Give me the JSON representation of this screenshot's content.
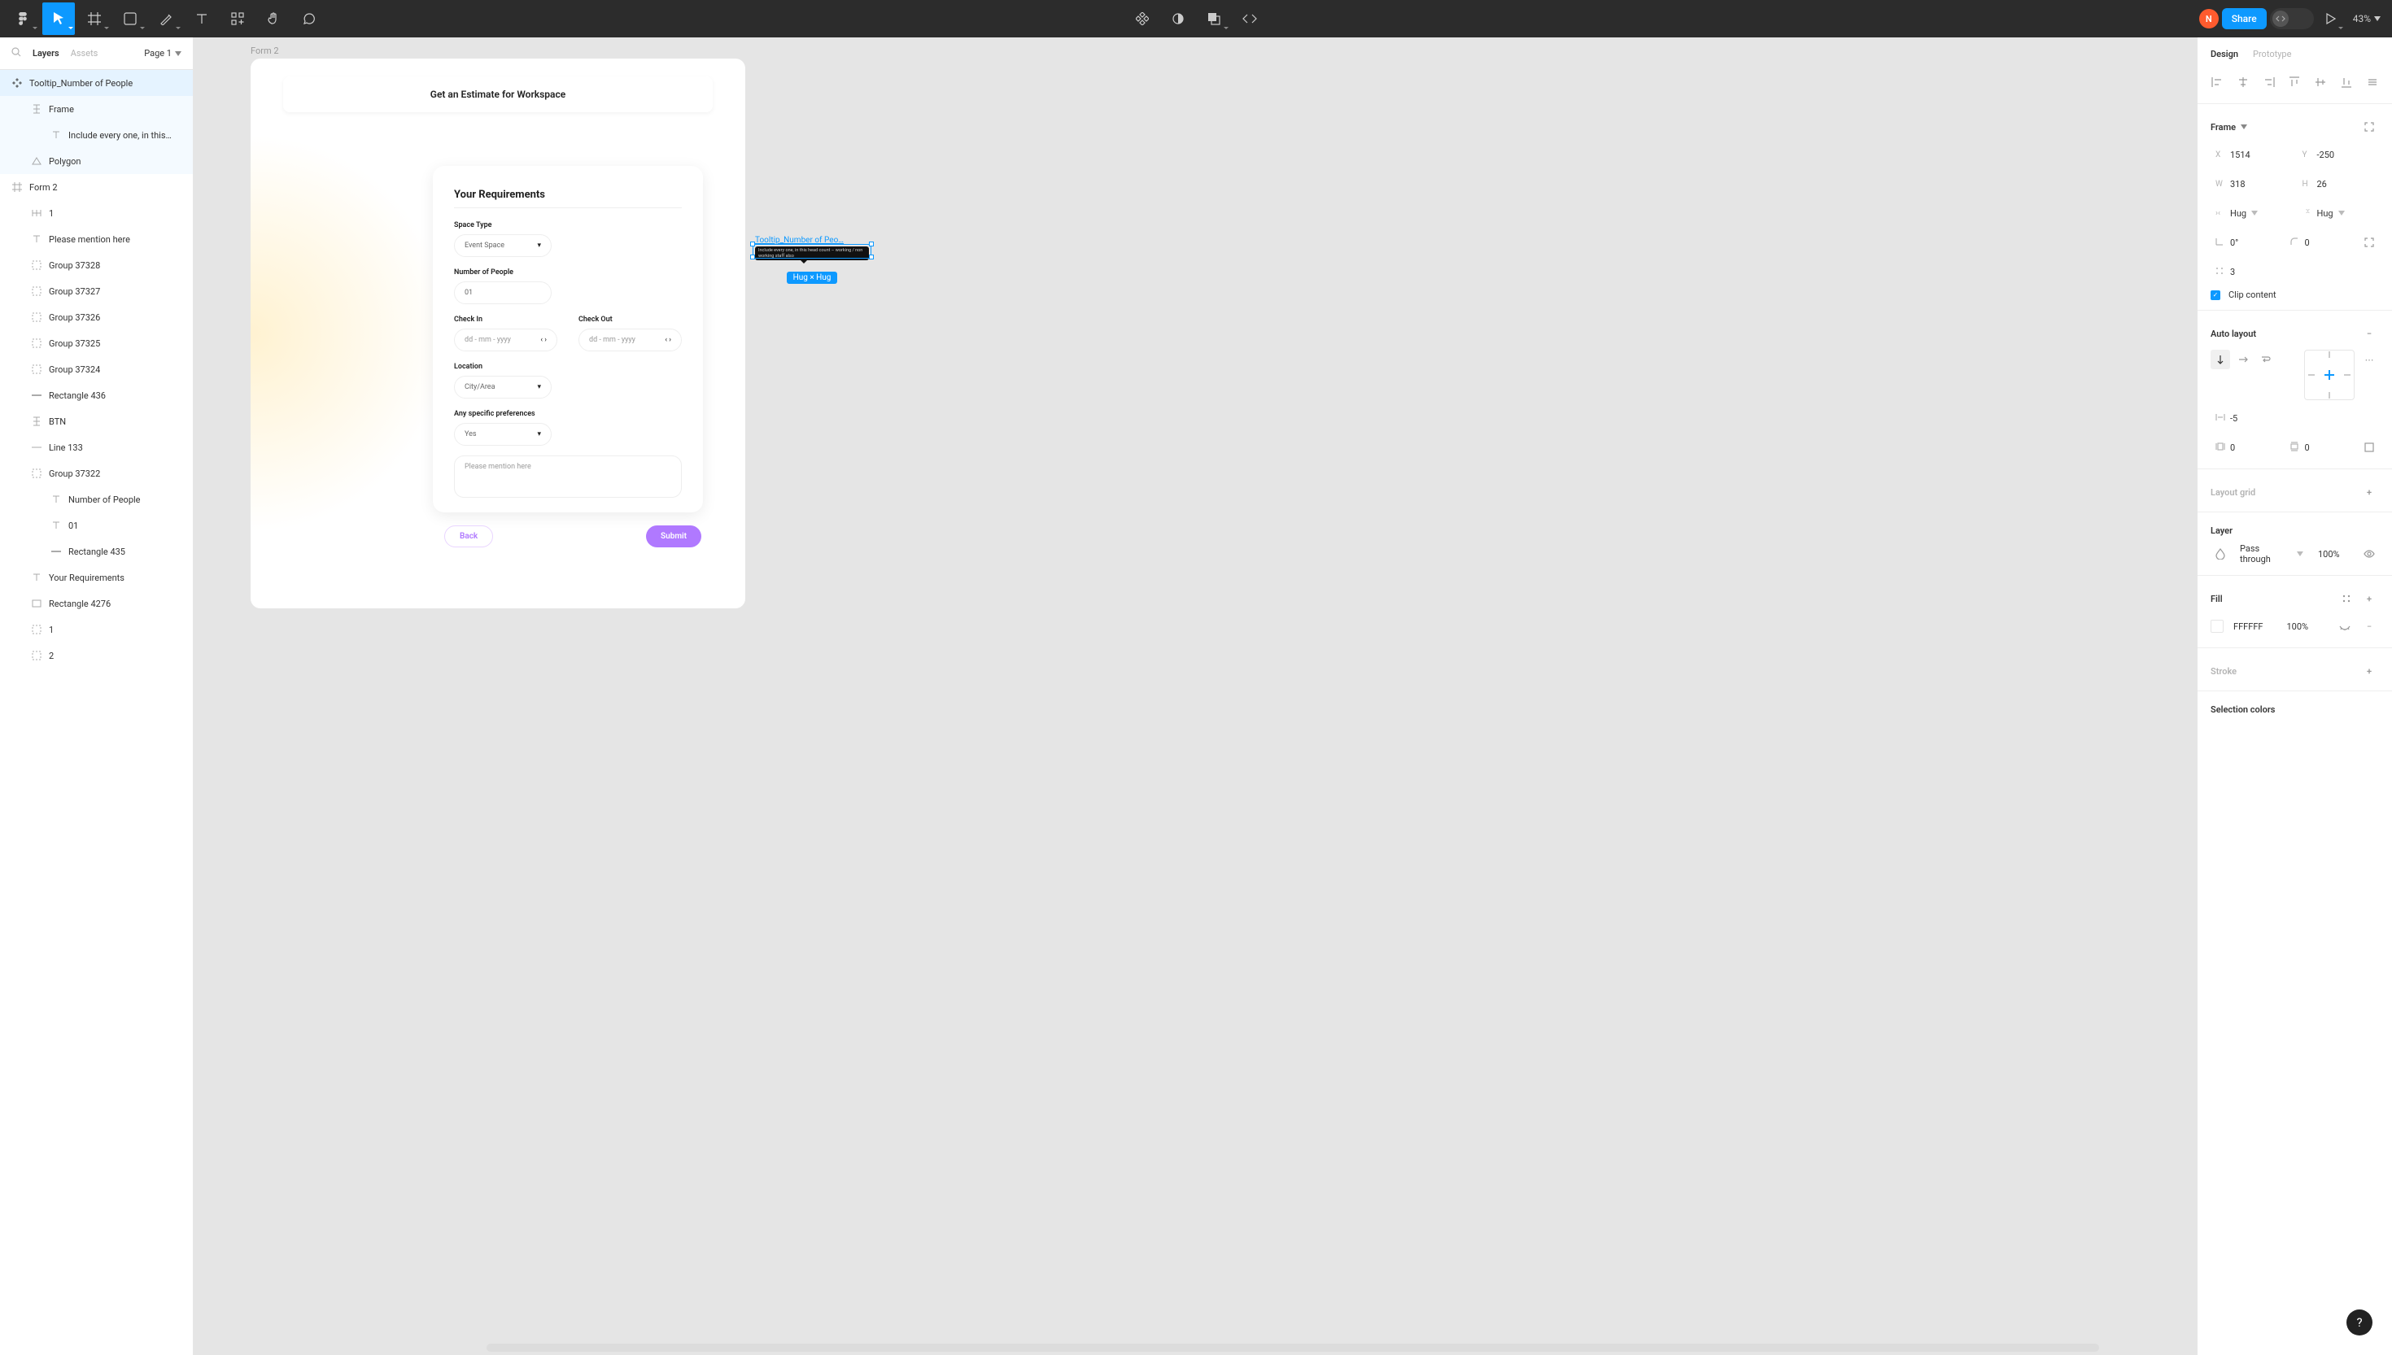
{
  "toolbar": {
    "zoom": "43%",
    "share": "Share",
    "avatar_initial": "N"
  },
  "left_panel": {
    "search_icon": "search",
    "tabs": {
      "layers": "Layers",
      "assets": "Assets"
    },
    "page_label": "Page 1",
    "layers": [
      {
        "name": "Tooltip_Number of People",
        "indent": 0,
        "icon": "component",
        "selected": true
      },
      {
        "name": "Frame",
        "indent": 1,
        "icon": "frame-v",
        "selected_inner": true
      },
      {
        "name": "Include every one, in this…",
        "indent": 2,
        "icon": "text",
        "selected_inner": true
      },
      {
        "name": "Polygon",
        "indent": 1,
        "icon": "polygon",
        "selected_inner": true
      },
      {
        "name": "Form 2",
        "indent": 0,
        "icon": "frame"
      },
      {
        "name": "1",
        "indent": 1,
        "icon": "frame-h"
      },
      {
        "name": "Please mention here",
        "indent": 1,
        "icon": "text"
      },
      {
        "name": "Group 37328",
        "indent": 1,
        "icon": "group"
      },
      {
        "name": "Group 37327",
        "indent": 1,
        "icon": "group"
      },
      {
        "name": "Group 37326",
        "indent": 1,
        "icon": "group"
      },
      {
        "name": "Group 37325",
        "indent": 1,
        "icon": "group"
      },
      {
        "name": "Group 37324",
        "indent": 1,
        "icon": "group"
      },
      {
        "name": "Rectangle 436",
        "indent": 1,
        "icon": "rect"
      },
      {
        "name": "BTN",
        "indent": 1,
        "icon": "frame-v"
      },
      {
        "name": "Line 133",
        "indent": 1,
        "icon": "line"
      },
      {
        "name": "Group 37322",
        "indent": 1,
        "icon": "group"
      },
      {
        "name": "Number of People",
        "indent": 2,
        "icon": "text"
      },
      {
        "name": "01",
        "indent": 2,
        "icon": "text"
      },
      {
        "name": "Rectangle 435",
        "indent": 2,
        "icon": "rect"
      },
      {
        "name": "Your Requirements",
        "indent": 1,
        "icon": "text"
      },
      {
        "name": "Rectangle 4276",
        "indent": 1,
        "icon": "rect-outline"
      },
      {
        "name": "1",
        "indent": 1,
        "icon": "group"
      },
      {
        "name": "2",
        "indent": 1,
        "icon": "group"
      }
    ]
  },
  "canvas": {
    "frame_label": "Form 2",
    "form": {
      "header": "Get an Estimate for Workspace",
      "section_title": "Your Requirements",
      "fields": {
        "space_type_label": "Space Type",
        "space_type_value": "Event Space",
        "people_label": "Number of People",
        "people_value": "01",
        "checkin_label": "Check In",
        "checkout_label": "Check Out",
        "date_placeholder": "dd - mm - yyyy",
        "location_label": "Location",
        "location_value": "City/Area",
        "prefs_label": "Any specific preferences",
        "prefs_value": "Yes",
        "textarea_placeholder": "Please mention here"
      },
      "buttons": {
        "back": "Back",
        "submit": "Submit"
      }
    },
    "selection": {
      "name": "Tooltip_Number of Peo…",
      "tooltip_text": "Include every one, in this head count – working / non working staff also",
      "size_badge": "Hug × Hug"
    }
  },
  "right_panel": {
    "tabs": {
      "design": "Design",
      "prototype": "Prototype"
    },
    "frame_section_label": "Frame",
    "x": "1514",
    "y": "-250",
    "w": "318",
    "h": "26",
    "constraint_w": "Hug",
    "constraint_h": "Hug",
    "rotation": "0°",
    "corner": "0",
    "gap_count": "3",
    "clip_content": "Clip content",
    "autolayout_label": "Auto layout",
    "al_spacing": "-5",
    "al_pad_h": "0",
    "al_pad_v": "0",
    "layout_grid_label": "Layout grid",
    "layer_label": "Layer",
    "blend_mode": "Pass through",
    "layer_opacity": "100%",
    "fill_label": "Fill",
    "fill_hex": "FFFFFF",
    "fill_opacity": "100%",
    "stroke_label": "Stroke",
    "selection_colors_label": "Selection colors"
  },
  "help": "?"
}
